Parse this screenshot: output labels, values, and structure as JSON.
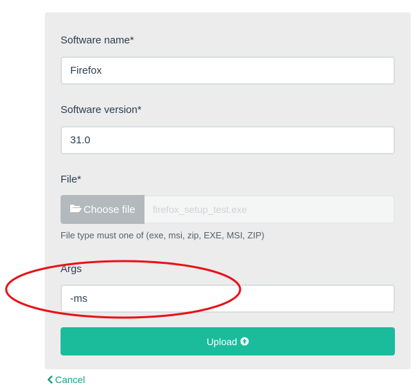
{
  "form": {
    "software_name": {
      "label": "Software name*",
      "value": "Firefox"
    },
    "software_version": {
      "label": "Software version*",
      "value": "31.0"
    },
    "file": {
      "label": "File*",
      "button_label": "Choose file",
      "button_icon": "folder-open-icon",
      "selected_file": "firefox_setup_test.exe",
      "help_text": "File type must one of (exe, msi, zip, EXE, MSI, ZIP)"
    },
    "args": {
      "label": "Args",
      "value": "-ms"
    },
    "upload_label": "Upload",
    "upload_icon": "arrow-circle-up-icon",
    "cancel_label": "Cancel",
    "cancel_icon": "chevron-left-icon"
  },
  "colors": {
    "panel_bg": "#ececec",
    "primary": "#1abc9c",
    "link": "#16a085",
    "annotation": "#e8121b"
  }
}
